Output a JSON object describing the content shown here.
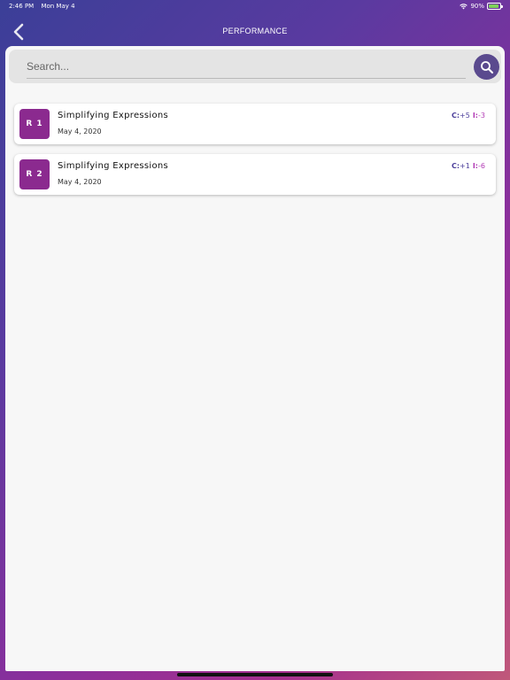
{
  "status_bar": {
    "time": "2:46 PM",
    "date": "Mon May 4",
    "battery": "90%"
  },
  "nav": {
    "title": "PERFORMANCE",
    "back_icon": "chevron-left-icon"
  },
  "search": {
    "placeholder": "Search...",
    "value": "",
    "icon": "search-icon"
  },
  "colors": {
    "badge": "#8b2a8f",
    "search_button": "#5a4a8e",
    "correct": "#4b3e9a",
    "incorrect": "#b23bb5"
  },
  "items": [
    {
      "badge": "R 1",
      "title": "Simplifying Expressions",
      "date": "May 4, 2020",
      "c_label": "C:",
      "c_value": "+5",
      "i_label": "I:",
      "i_value": "-3"
    },
    {
      "badge": "R 2",
      "title": "Simplifying Expressions",
      "date": "May 4, 2020",
      "c_label": "C:",
      "c_value": "+1",
      "i_label": "I:",
      "i_value": "-6"
    }
  ]
}
